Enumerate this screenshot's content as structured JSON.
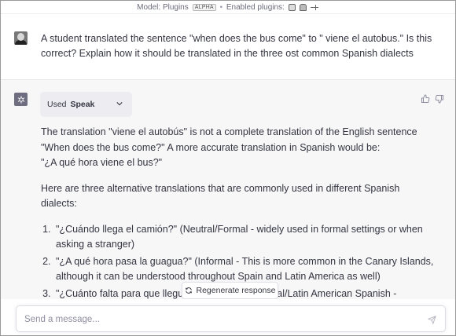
{
  "model_bar": {
    "model_label": "Model: Plugins",
    "alpha_badge": "ALPHA",
    "separator": "•",
    "enabled_label": "Enabled plugins:"
  },
  "conversation": {
    "user_message": "A student translated the sentence \"when does the bus come\" to \" viene el autobus.\" Is this correct? Explain how it should be translated in the three ost common Spanish dialects",
    "assistant": {
      "plugin_used_prefix": "Used",
      "plugin_name": "Speak",
      "intro_line1": "The translation \"viene el autobús\" is not a complete translation of the English sentence \"When does the bus come?\" A more accurate translation in Spanish would be:",
      "intro_line2": "\"¿A qué hora viene el bus?\"",
      "list_intro": "Here are three alternative translations that are commonly used in different Spanish dialects:",
      "items": [
        "\"¿Cuándo llega el camión?\" (Neutral/Formal - widely used in formal settings or when asking a stranger)",
        "\"¿A qué hora pasa la guagua?\" (Informal - This is more common in the Canary Islands, although it can be understood throughout Spain and Latin America as well)",
        "\"¿Cuánto falta para que llegue el ómnibus?\" (Formal/Latin American Spanish - commonly used in Argentina, Cuba, Uruguay, and other Latin American countries)"
      ]
    }
  },
  "regenerate_label": "Regenerate response",
  "input": {
    "placeholder": "Send a message..."
  }
}
